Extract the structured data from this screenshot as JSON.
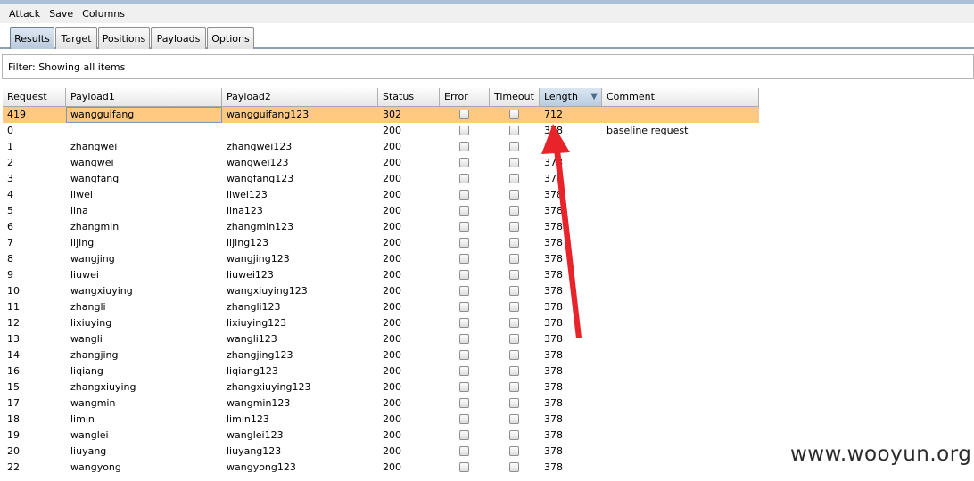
{
  "menu": [
    "Attack",
    "Save",
    "Columns"
  ],
  "tabs": [
    "Results",
    "Target",
    "Positions",
    "Payloads",
    "Options"
  ],
  "active_tab": "Results",
  "filter": {
    "text": "Filter:  Showing all items"
  },
  "table": {
    "columns": [
      "Request",
      "Payload1",
      "Payload2",
      "Status",
      "Error",
      "Timeout",
      "Length",
      "Comment"
    ],
    "sorted_column": "Length",
    "sort_direction": "descending",
    "rows": [
      {
        "request": "419",
        "payload1": "wangguifang",
        "payload2": "wangguifang123",
        "status": "302",
        "length": "712",
        "comment": "",
        "selected": true
      },
      {
        "request": "0",
        "payload1": "",
        "payload2": "",
        "status": "200",
        "length": "378",
        "comment": "baseline request"
      },
      {
        "request": "1",
        "payload1": "zhangwei",
        "payload2": "zhangwei123",
        "status": "200",
        "length": "378",
        "comment": ""
      },
      {
        "request": "2",
        "payload1": "wangwei",
        "payload2": "wangwei123",
        "status": "200",
        "length": "378",
        "comment": ""
      },
      {
        "request": "3",
        "payload1": "wangfang",
        "payload2": "wangfang123",
        "status": "200",
        "length": "378",
        "comment": ""
      },
      {
        "request": "4",
        "payload1": "liwei",
        "payload2": "liwei123",
        "status": "200",
        "length": "378",
        "comment": ""
      },
      {
        "request": "5",
        "payload1": "lina",
        "payload2": "lina123",
        "status": "200",
        "length": "378",
        "comment": ""
      },
      {
        "request": "6",
        "payload1": "zhangmin",
        "payload2": "zhangmin123",
        "status": "200",
        "length": "378",
        "comment": ""
      },
      {
        "request": "7",
        "payload1": "lijing",
        "payload2": "lijing123",
        "status": "200",
        "length": "378",
        "comment": ""
      },
      {
        "request": "8",
        "payload1": "wangjing",
        "payload2": "wangjing123",
        "status": "200",
        "length": "378",
        "comment": ""
      },
      {
        "request": "9",
        "payload1": "liuwei",
        "payload2": "liuwei123",
        "status": "200",
        "length": "378",
        "comment": ""
      },
      {
        "request": "10",
        "payload1": "wangxiuying",
        "payload2": "wangxiuying123",
        "status": "200",
        "length": "378",
        "comment": ""
      },
      {
        "request": "11",
        "payload1": "zhangli",
        "payload2": "zhangli123",
        "status": "200",
        "length": "378",
        "comment": ""
      },
      {
        "request": "12",
        "payload1": "lixiuying",
        "payload2": "lixiuying123",
        "status": "200",
        "length": "378",
        "comment": ""
      },
      {
        "request": "13",
        "payload1": "wangli",
        "payload2": "wangli123",
        "status": "200",
        "length": "378",
        "comment": ""
      },
      {
        "request": "14",
        "payload1": "zhangjing",
        "payload2": "zhangjing123",
        "status": "200",
        "length": "378",
        "comment": ""
      },
      {
        "request": "16",
        "payload1": "liqiang",
        "payload2": "liqiang123",
        "status": "200",
        "length": "378",
        "comment": ""
      },
      {
        "request": "15",
        "payload1": "zhangxiuying",
        "payload2": "zhangxiuying123",
        "status": "200",
        "length": "378",
        "comment": ""
      },
      {
        "request": "17",
        "payload1": "wangmin",
        "payload2": "wangmin123",
        "status": "200",
        "length": "378",
        "comment": ""
      },
      {
        "request": "18",
        "payload1": "limin",
        "payload2": "limin123",
        "status": "200",
        "length": "378",
        "comment": ""
      },
      {
        "request": "19",
        "payload1": "wanglei",
        "payload2": "wanglei123",
        "status": "200",
        "length": "378",
        "comment": ""
      },
      {
        "request": "20",
        "payload1": "liuyang",
        "payload2": "liuyang123",
        "status": "200",
        "length": "378",
        "comment": ""
      },
      {
        "request": "22",
        "payload1": "wangyong",
        "payload2": "wangyong123",
        "status": "200",
        "length": "378",
        "comment": ""
      }
    ]
  },
  "colors": {
    "selected_row": "#ffc982",
    "annotation_arrow": "#e8232a"
  },
  "annotation": {
    "icon": "red-arrow-icon"
  },
  "watermark": "www.wooyun.org"
}
